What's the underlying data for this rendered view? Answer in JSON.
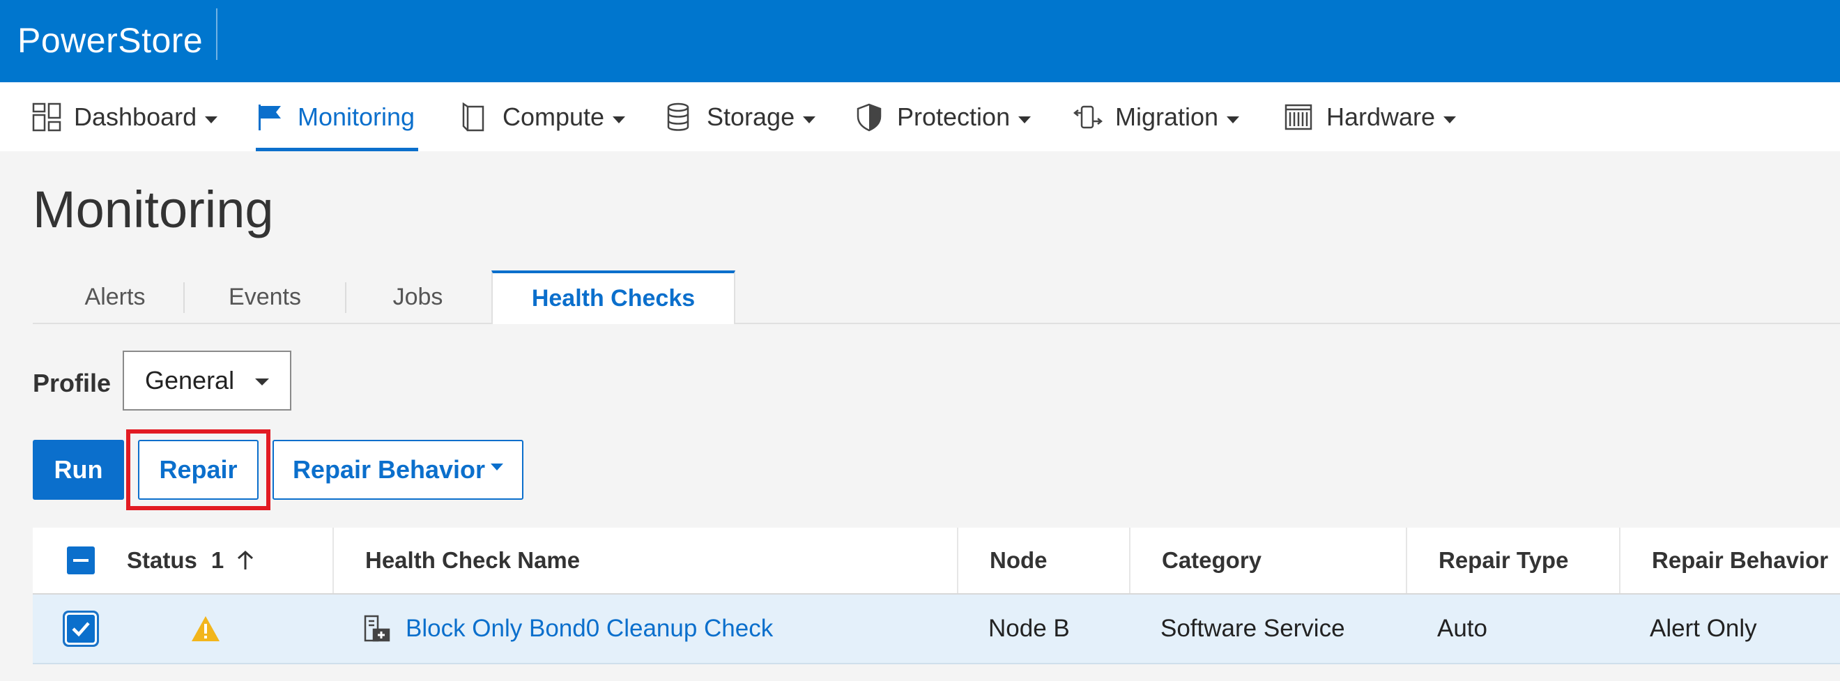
{
  "app": {
    "name": "PowerStore"
  },
  "nav": {
    "items": [
      {
        "label": "Dashboard",
        "icon": "dashboard-grid-icon",
        "has_caret": true
      },
      {
        "label": "Monitoring",
        "icon": "flag-icon",
        "has_caret": false,
        "active": true
      },
      {
        "label": "Compute",
        "icon": "compute-icon",
        "has_caret": true
      },
      {
        "label": "Storage",
        "icon": "database-icon",
        "has_caret": true
      },
      {
        "label": "Protection",
        "icon": "shield-icon",
        "has_caret": true
      },
      {
        "label": "Migration",
        "icon": "migration-icon",
        "has_caret": true
      },
      {
        "label": "Hardware",
        "icon": "hardware-icon",
        "has_caret": true
      }
    ]
  },
  "page": {
    "title": "Monitoring"
  },
  "tabs": [
    {
      "label": "Alerts"
    },
    {
      "label": "Events"
    },
    {
      "label": "Jobs"
    },
    {
      "label": "Health Checks",
      "active": true
    }
  ],
  "profile": {
    "label": "Profile",
    "selected": "General"
  },
  "toolbar": {
    "run_label": "Run",
    "repair_label": "Repair",
    "repair_behavior_label": "Repair Behavior"
  },
  "table": {
    "columns": {
      "status": "Status",
      "sort_order": "1",
      "name": "Health Check Name",
      "node": "Node",
      "category": "Category",
      "repair_type": "Repair Type",
      "repair_behavior": "Repair Behavior"
    },
    "rows": [
      {
        "selected": true,
        "status": "warning",
        "name": "Block Only Bond0 Cleanup Check",
        "node": "Node B",
        "category": "Software Service",
        "repair_type": "Auto",
        "repair_behavior": "Alert Only"
      }
    ]
  },
  "colors": {
    "brand_blue": "#0076ce",
    "accent": "#0b6fcc",
    "highlight": "#e21b23",
    "warning": "#f2b51b",
    "selected_row": "#e4f0fa"
  }
}
